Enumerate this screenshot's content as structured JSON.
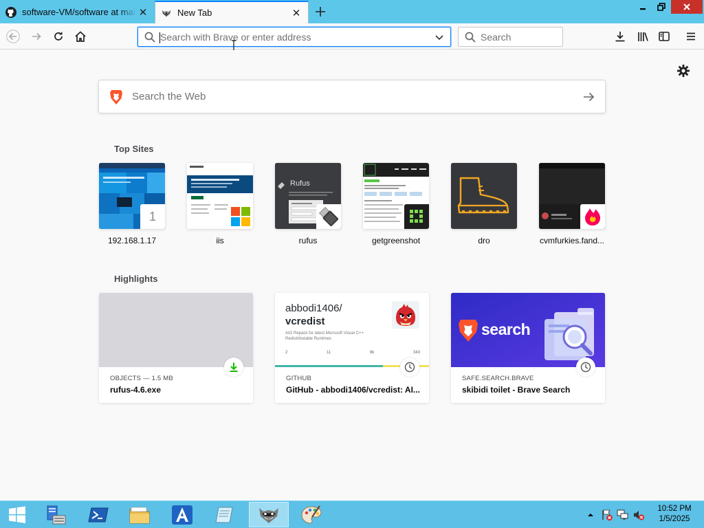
{
  "tabs": [
    {
      "title": "software-VM/software at main",
      "active": false
    },
    {
      "title": "New Tab",
      "active": true
    }
  ],
  "navbar": {
    "url_placeholder": "Search with Brave or enter address",
    "search_placeholder": "Search"
  },
  "newtab": {
    "websearch_placeholder": "Search the Web",
    "top_sites_title": "Top Sites",
    "top_sites": [
      {
        "label": "192.168.1.17",
        "badge": "1"
      },
      {
        "label": "iis"
      },
      {
        "label": "rufus",
        "thumb_text": "Rufus"
      },
      {
        "label": "getgreenshot"
      },
      {
        "label": "dro"
      },
      {
        "label": "cvmfurkies.fand..."
      }
    ],
    "highlights_title": "Highlights",
    "highlights": [
      {
        "context": "OBJECTS — 1.5 MB",
        "title": "rufus-4.6.exe",
        "icon": "download-icon"
      },
      {
        "context": "GITHUB",
        "title": "GitHub - abbodi1406/vcredist: AI...",
        "icon": "clock-icon",
        "preview": {
          "owner": "abbodi1406/",
          "repo": "vcredist",
          "desc": "AIO Repack for latest Microsoft Visual C++ Redistributable Runtimes",
          "stats": [
            "2",
            "11",
            "8k",
            "343"
          ]
        }
      },
      {
        "context": "SAFE.SEARCH.BRAVE",
        "title": "skibidi toilet - Brave Search",
        "icon": "clock-icon",
        "preview": {
          "brand": "search"
        }
      }
    ]
  },
  "taskbar": {
    "time": "10:52 PM",
    "date": "1/5/2025"
  },
  "colors": {
    "tabstrip": "#5dc7ea",
    "accent": "#0a84ff",
    "taskbar": "#5dc0e6",
    "brave_orange": "#fb542b",
    "brave_purple": "#3b2ed1"
  }
}
